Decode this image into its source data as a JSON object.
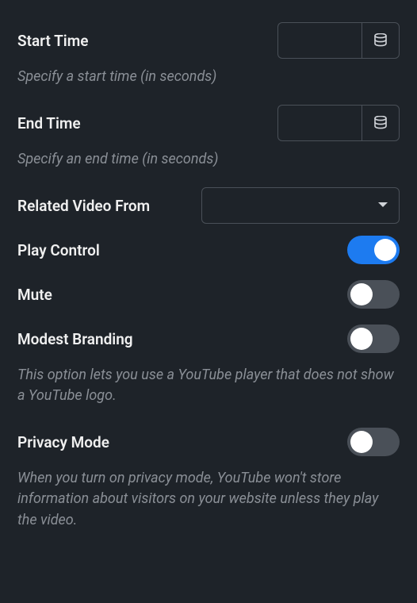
{
  "startTime": {
    "label": "Start Time",
    "value": "",
    "help": "Specify a start time (in seconds)"
  },
  "endTime": {
    "label": "End Time",
    "value": "",
    "help": "Specify an end time (in seconds)"
  },
  "relatedVideo": {
    "label": "Related Video From",
    "value": ""
  },
  "playControl": {
    "label": "Play Control",
    "on": true
  },
  "mute": {
    "label": "Mute",
    "on": false
  },
  "modestBranding": {
    "label": "Modest Branding",
    "on": false,
    "help": "This option lets you use a YouTube player that does not show a YouTube logo."
  },
  "privacyMode": {
    "label": "Privacy Mode",
    "on": false,
    "help": "When you turn on privacy mode, YouTube won't store information about visitors on your website unless they play the video."
  }
}
